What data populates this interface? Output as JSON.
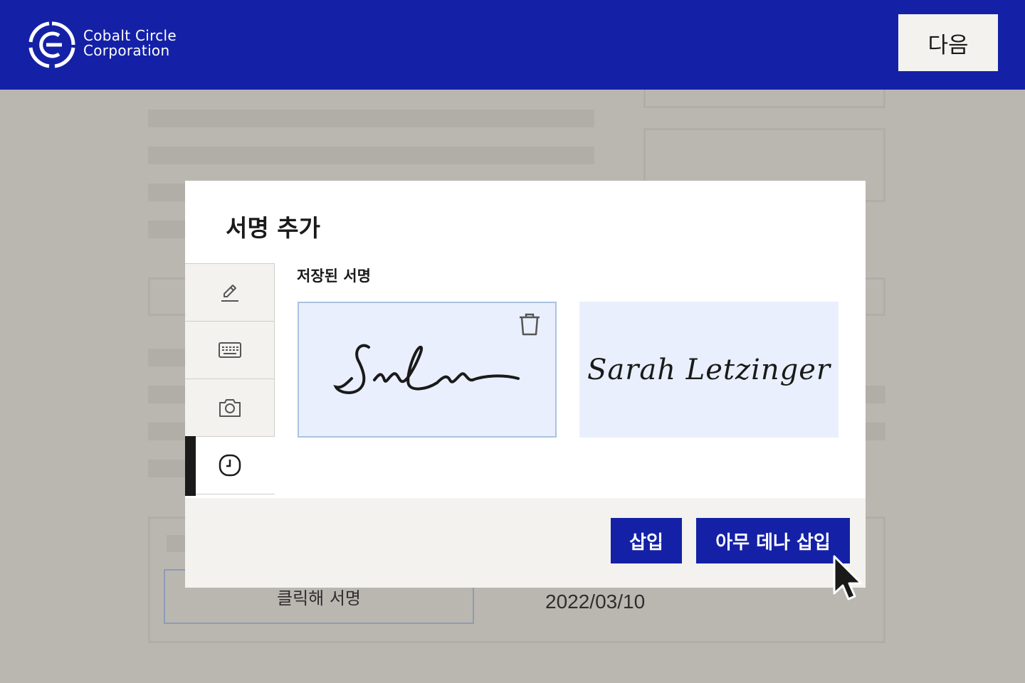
{
  "header": {
    "brand_line1": "Cobalt Circle",
    "brand_line2": "Corporation",
    "next_label": "다음",
    "color": "#1421a6",
    "logo_icon": "cobalt-circle-logo"
  },
  "modal": {
    "title": "서명 추가",
    "tabs": [
      {
        "icon": "pen-icon",
        "active": false
      },
      {
        "icon": "keyboard-icon",
        "active": false
      },
      {
        "icon": "camera-icon",
        "active": false
      },
      {
        "icon": "clock-icon",
        "active": true
      }
    ],
    "saved_label": "저장된 서명",
    "signatures": [
      {
        "text": "SnLn",
        "selected": true,
        "style": "handwritten-initials"
      },
      {
        "text": "Sarah Letzinger",
        "selected": false,
        "style": "script"
      }
    ],
    "insert_label": "삽입",
    "insert_anywhere_label": "아무 데나 삽입",
    "accent": "#1421a6",
    "card_bg": "#e9effc"
  },
  "document": {
    "click_to_sign": "클릭해 서명",
    "date": "2022/03/10"
  }
}
